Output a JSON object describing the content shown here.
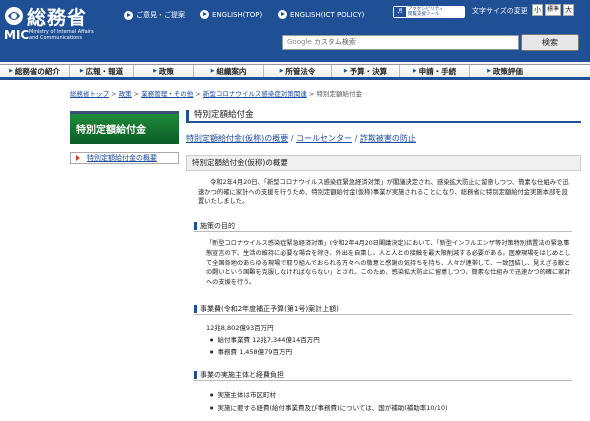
{
  "header": {
    "logo_ja": "総務省",
    "logo_mic": "MIC",
    "logo_en_line1": "Ministry of Internal Affairs",
    "logo_en_line2": "and Communications",
    "links": [
      "ご意見・ご提案",
      "ENGLISH(TOP)",
      "ENGLISH(ICT POLICY)"
    ],
    "access_line1": "アクセシビリティ",
    "access_line2": "閲覧支援ツール",
    "fontsize_label": "文字サイズの変更",
    "fontsizes": [
      "小",
      "標準",
      "大"
    ],
    "search_placeholder_prefix": "Google",
    "search_placeholder": "カスタム検索",
    "search_button": "検索",
    "colors": {
      "brand": "#1f4f95",
      "side_green": "#0b5d25",
      "link": "#1a4aa0"
    }
  },
  "gnav": [
    "総務省の紹介",
    "広報・報道",
    "政策",
    "組織案内",
    "所管法令",
    "予算・決算",
    "申請・手続",
    "政策評価"
  ],
  "breadcrumb": {
    "items": [
      "総務省トップ",
      "政策",
      "業務管理・その他",
      "新型コロナウイルス感染症対策関連"
    ],
    "sep": ">",
    "current": "特別定額給付金"
  },
  "sidebar": {
    "title": "特別定額給付金",
    "items": [
      "特別定額給付金の概要"
    ]
  },
  "main": {
    "title": "特別定額給付金",
    "links": [
      "特別定額給付金(仮称)の概要",
      "コールセンター",
      "詐欺被害の防止"
    ],
    "link_sep": "/",
    "section_title": "特別定額給付金(仮称)の概要",
    "intro": "令和2年4月20日、「新型コロナウイルス感染症緊急経済対策」が閣議決定され、感染拡大防止に留意しつつ、簡素な仕組みで迅速かつ的確に家計への支援を行うため、特別定額給付金(仮称)事業が実施されることになり、総務省に特別定額給付金実施本部を設置いたしました。",
    "purpose_heading": "施策の目的",
    "purpose": "「新型コロナウイルス感染症緊急経済対策」(令和2年4月20日閣議決定)において、「新型インフルエンザ等対策特別措置法の緊急事態宣言の下、生活の維持に必要な場合を除き、外出を自粛し、人と人との接触を最大限削減する必要がある。医療現場をはじめとして全国各地のあらゆる現場で取り組んでおられる方々への敬意と感謝の気持ちを持ち、人々が連帯して、一致団結し、見えざる敵との闘いという国難を克服しなければならない」とされ、このため、感染拡大防止に留意しつつ、簡素な仕組みで迅速かつ的確に家計への支援を行う。",
    "budget_heading": "事業費(令和2年度補正予算(第1号)案計上額)",
    "budget_total": "12兆8,802億93百万円",
    "budget_items": [
      "給付事業費 12兆7,344億14百万円",
      "事務費 1,458億79百万円"
    ],
    "impl_heading": "事業の実施主体と経費負担",
    "impl_items": [
      "実施主体は市区町村",
      "実施に要する経費(給付事業費及び事務費)については、国が補助(補助率10/10)"
    ]
  }
}
